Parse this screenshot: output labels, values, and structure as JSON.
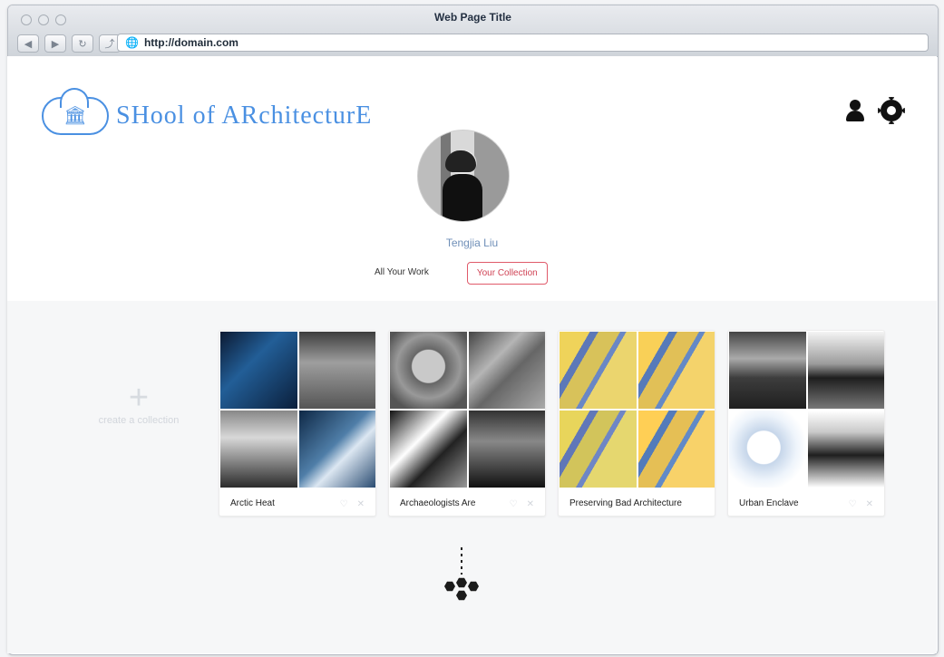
{
  "browser": {
    "title": "Web Page Title",
    "url": "http://domain.com"
  },
  "brand": {
    "name": "SHool of ARchitecturE"
  },
  "profile": {
    "name": "Tengjia Liu"
  },
  "tabs": [
    {
      "label": "All Your Work"
    },
    {
      "label": "Your Collection"
    }
  ],
  "create": {
    "label": "create a collection"
  },
  "collections": [
    {
      "title": "Arctic Heat",
      "actions": [
        "♡",
        "✕"
      ]
    },
    {
      "title": "Archaeologists Are",
      "actions": [
        "♡",
        "✕"
      ]
    },
    {
      "title": "Preserving Bad Architecture",
      "actions": [
        "♡",
        "✕"
      ]
    },
    {
      "title": "Urban Enclave",
      "actions": [
        "♡",
        "✕"
      ]
    }
  ]
}
